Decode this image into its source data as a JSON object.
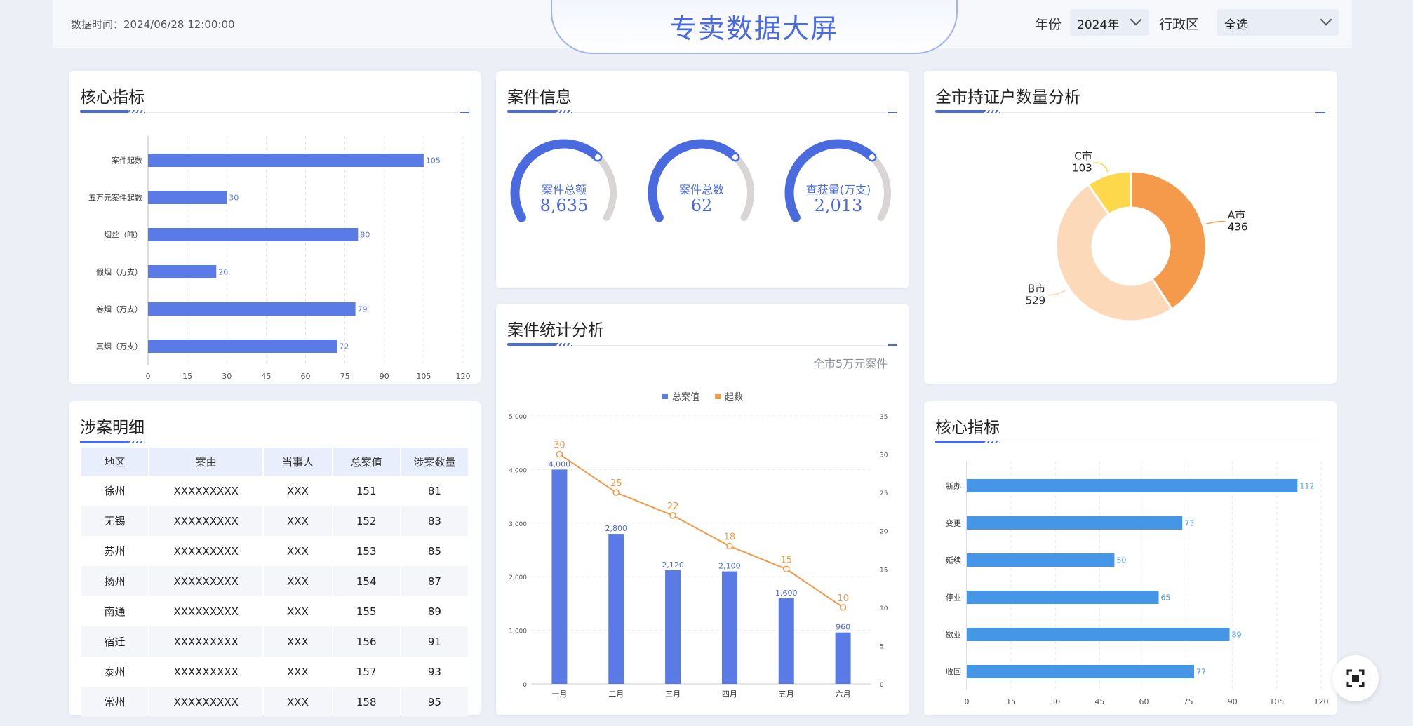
{
  "header": {
    "data_time": "数据时间：2024/06/28 12:00:00",
    "title": "专卖数据大屏",
    "year_label": "年份",
    "year_value": "2024年",
    "region_label": "行政区",
    "region_value": "全选"
  },
  "panels": {
    "core1_title": "核心指标",
    "case_info_title": "案件信息",
    "holders_title": "全市持证户数量分析",
    "detail_title": "涉案明细",
    "case_stats_title": "案件统计分析",
    "case_stats_note": "全市5万元案件",
    "core2_title": "核心指标"
  },
  "gauges": [
    {
      "label": "案件总额",
      "value": "8,635",
      "fraction": 0.68
    },
    {
      "label": "案件总数",
      "value": "62",
      "fraction": 0.68
    },
    {
      "label": "查获量(万支)",
      "value": "2,013",
      "fraction": 0.68
    }
  ],
  "table": {
    "headers": [
      "地区",
      "案由",
      "当事人",
      "总案值",
      "涉案数量"
    ],
    "rows": [
      [
        "徐州",
        "XXXXXXXXX",
        "XXX",
        "151",
        "81"
      ],
      [
        "无锡",
        "XXXXXXXXX",
        "XXX",
        "152",
        "83"
      ],
      [
        "苏州",
        "XXXXXXXXX",
        "XXX",
        "153",
        "85"
      ],
      [
        "扬州",
        "XXXXXXXXX",
        "XXX",
        "154",
        "87"
      ],
      [
        "南通",
        "XXXXXXXXX",
        "XXX",
        "155",
        "89"
      ],
      [
        "宿迁",
        "XXXXXXXXX",
        "XXX",
        "156",
        "91"
      ],
      [
        "泰州",
        "XXXXXXXXX",
        "XXX",
        "157",
        "93"
      ],
      [
        "常州",
        "XXXXXXXXX",
        "XXX",
        "158",
        "95"
      ]
    ]
  },
  "colors": {
    "accent": "#4a6ae0",
    "bar_blue": "#5a7be6",
    "bar_sky": "#4596e6",
    "line_orange": "#f29a4a",
    "gauge_track": "#d9d5d5"
  },
  "chart_data": [
    {
      "type": "bar",
      "orientation": "horizontal",
      "categories": [
        "案件起数",
        "五万元案件起数",
        "烟丝（吨）",
        "假烟（万支）",
        "卷烟（万支）",
        "真烟（万支）"
      ],
      "values": [
        105,
        30,
        80,
        26,
        79,
        72
      ],
      "xlim": [
        0,
        120
      ],
      "xticks": [
        0,
        15,
        30,
        45,
        60,
        75,
        90,
        105,
        120
      ],
      "grid": true
    },
    {
      "type": "pie",
      "donut": true,
      "labels": [
        "A市",
        "B市",
        "C市"
      ],
      "values": [
        436,
        529,
        103
      ],
      "colors": [
        "#f59a4a",
        "#fcd9b9",
        "#fdd84a"
      ]
    },
    {
      "type": "bar",
      "categories": [
        "一月",
        "二月",
        "三月",
        "四月",
        "五月",
        "六月"
      ],
      "series": [
        {
          "name": "总案值",
          "type": "bar",
          "axis": "left",
          "values": [
            4000,
            2800,
            2120,
            2100,
            1600,
            960
          ]
        },
        {
          "name": "起数",
          "type": "line",
          "axis": "right",
          "values": [
            30,
            25,
            22,
            18,
            15,
            10
          ]
        }
      ],
      "ylim_left": [
        0,
        5000
      ],
      "yticks_left": [
        "0",
        "1,000",
        "2,000",
        "3,000",
        "4,000",
        "5,000"
      ],
      "ylim_right": [
        0,
        35
      ],
      "yticks_right": [
        0,
        5,
        10,
        15,
        20,
        25,
        30,
        35
      ],
      "legend": "top-center",
      "grid": true
    },
    {
      "type": "bar",
      "orientation": "horizontal",
      "categories": [
        "新办",
        "变更",
        "延续",
        "停业",
        "歇业",
        "收回"
      ],
      "values": [
        112,
        73,
        50,
        65,
        89,
        77
      ],
      "xlim": [
        0,
        120
      ],
      "xticks": [
        0,
        15,
        30,
        45,
        60,
        75,
        90,
        105,
        120
      ],
      "grid": true
    }
  ]
}
